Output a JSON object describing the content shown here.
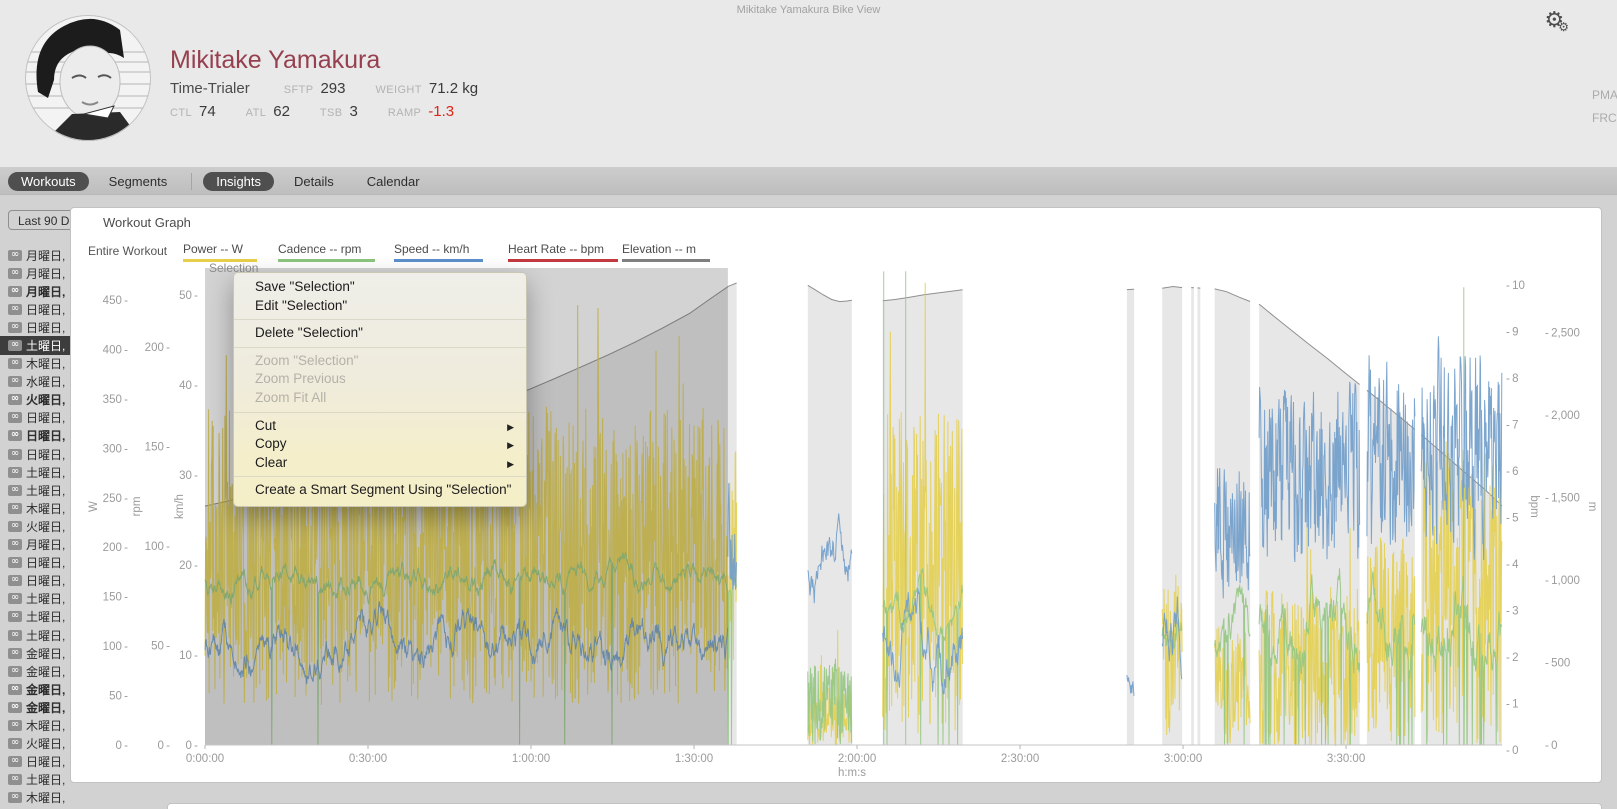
{
  "window": {
    "title": "Mikitake Yamakura Bike View"
  },
  "header": {
    "name": "Mikitake Yamakura",
    "athlete_type": "Time-Trialer",
    "stats_row1": [
      {
        "label": "SFTP",
        "value": "293"
      },
      {
        "label": "WEIGHT",
        "value": "71.2 kg"
      }
    ],
    "stats_row2": [
      {
        "label": "CTL",
        "value": "74"
      },
      {
        "label": "ATL",
        "value": "62"
      },
      {
        "label": "TSB",
        "value": "3"
      },
      {
        "label": "RAMP",
        "value": "-1.3",
        "value_color": "#e02519"
      }
    ],
    "right_metrics": [
      "PMA",
      "FRC"
    ]
  },
  "tabs": [
    {
      "label": "Workouts",
      "selected": true
    },
    {
      "label": "Segments",
      "selected": false,
      "separator_after": true
    },
    {
      "label": "Insights",
      "selected": true
    },
    {
      "label": "Details",
      "selected": false
    },
    {
      "label": "Calendar",
      "selected": false
    }
  ],
  "sidebar": {
    "filter_button": "Last 90 D",
    "items": [
      {
        "label": "月曜日,"
      },
      {
        "label": "月曜日,"
      },
      {
        "label": "月曜日,",
        "bold": true
      },
      {
        "label": "日曜日,"
      },
      {
        "label": "日曜日,"
      },
      {
        "label": "土曜日,",
        "selected": true
      },
      {
        "label": "木曜日,"
      },
      {
        "label": "水曜日,"
      },
      {
        "label": "火曜日,",
        "bold": true
      },
      {
        "label": "日曜日,"
      },
      {
        "label": "日曜日,",
        "bold": true
      },
      {
        "label": "日曜日,"
      },
      {
        "label": "土曜日,"
      },
      {
        "label": "土曜日,"
      },
      {
        "label": "木曜日,"
      },
      {
        "label": "火曜日,"
      },
      {
        "label": "月曜日,"
      },
      {
        "label": "日曜日,"
      },
      {
        "label": "日曜日,"
      },
      {
        "label": "土曜日,"
      },
      {
        "label": "土曜日,"
      },
      {
        "label": "土曜日,"
      },
      {
        "label": "金曜日,"
      },
      {
        "label": "金曜日,"
      },
      {
        "label": "金曜日,",
        "bold": true
      },
      {
        "label": "金曜日,",
        "bold": true
      },
      {
        "label": "木曜日,"
      },
      {
        "label": "火曜日,"
      },
      {
        "label": "日曜日,"
      },
      {
        "label": "土曜日,"
      },
      {
        "label": "木曜日,"
      }
    ]
  },
  "panel": {
    "title": "Workout Graph",
    "scope_label": "Entire Workout",
    "legend": [
      {
        "name": "Power",
        "unit": "W",
        "color": "#e7cf4b"
      },
      {
        "name": "Cadence",
        "unit": "rpm",
        "color": "#8cc47e"
      },
      {
        "name": "Speed",
        "unit": "km/h",
        "color": "#5b90cb"
      },
      {
        "name": "Heart Rate",
        "unit": "bpm",
        "color": "#c2393f"
      },
      {
        "name": "Elevation",
        "unit": "m",
        "color": "#7f7f7f"
      }
    ]
  },
  "context_menu": {
    "items": [
      {
        "label": "Save \"Selection\""
      },
      {
        "label": "Edit \"Selection\""
      },
      {
        "type": "separator"
      },
      {
        "label": "Delete \"Selection\""
      },
      {
        "type": "separator"
      },
      {
        "label": "Zoom \"Selection\"",
        "disabled": true
      },
      {
        "label": "Zoom Previous",
        "disabled": true
      },
      {
        "label": "Zoom Fit All",
        "disabled": true
      },
      {
        "type": "separator"
      },
      {
        "label": "Cut",
        "submenu": true
      },
      {
        "label": "Copy",
        "submenu": true
      },
      {
        "label": "Clear",
        "submenu": true
      },
      {
        "type": "separator"
      },
      {
        "label": "Create a Smart Segment Using \"Selection\""
      }
    ]
  },
  "chart_data": {
    "type": "line",
    "title": "Workout Graph",
    "x_axis": {
      "label": "h:m:s",
      "range_seconds": [
        0,
        14322
      ],
      "tick_interval_seconds": 1800,
      "tick_labels": [
        "0:00:00",
        "0:30:00",
        "1:00:00",
        "1:30:00",
        "2:00:00",
        "2:30:00",
        "3:00:00",
        "3:30:00"
      ]
    },
    "y_axes": [
      {
        "id": "power",
        "title": "W",
        "side": "left",
        "ticks": [
          0,
          50,
          100,
          150,
          200,
          250,
          300,
          350,
          400,
          450
        ]
      },
      {
        "id": "cadence",
        "title": "rpm",
        "side": "left",
        "ticks": [
          0,
          50,
          100,
          150,
          200
        ]
      },
      {
        "id": "speed",
        "title": "km/h",
        "side": "left",
        "ticks": [
          0,
          10,
          20,
          30,
          40,
          50
        ]
      },
      {
        "id": "hr",
        "title": "bpm",
        "side": "right",
        "ticks": [
          0,
          1,
          2,
          3,
          4,
          5,
          6,
          7,
          8,
          9,
          10
        ]
      },
      {
        "id": "elevation",
        "title": "m",
        "side": "right",
        "ticks": [
          0,
          500,
          1000,
          1500,
          2000,
          2500
        ]
      }
    ],
    "selection": {
      "label": "Selection",
      "start_seconds": 0,
      "end_seconds": 5774
    },
    "series": {
      "elevation_m": {
        "color": "#8f8f8f",
        "fill": "#e3e3e3",
        "segments": [
          [
            [
              0,
              1448
            ],
            [
              250,
              1478
            ],
            [
              550,
              1528
            ],
            [
              850,
              1582
            ],
            [
              1150,
              1640
            ],
            [
              1450,
              1700
            ],
            [
              1750,
              1760
            ],
            [
              2050,
              1822
            ],
            [
              2350,
              1886
            ],
            [
              2650,
              1950
            ],
            [
              2950,
              2014
            ],
            [
              3250,
              2080
            ],
            [
              3550,
              2148
            ],
            [
              3850,
              2218
            ],
            [
              4150,
              2290
            ],
            [
              4450,
              2364
            ],
            [
              4750,
              2442
            ],
            [
              5050,
              2526
            ],
            [
              5350,
              2615
            ],
            [
              5600,
              2712
            ],
            [
              5780,
              2780
            ],
            [
              5870,
              2800
            ]
          ],
          [
            [
              6656,
              2786
            ],
            [
              6740,
              2758
            ],
            [
              6820,
              2730
            ],
            [
              6920,
              2700
            ],
            [
              7010,
              2687
            ],
            [
              7090,
              2691
            ],
            [
              7142,
              2695
            ]
          ],
          [
            [
              7483,
              2692
            ],
            [
              7620,
              2700
            ],
            [
              7780,
              2714
            ],
            [
              7940,
              2729
            ],
            [
              8100,
              2740
            ],
            [
              8240,
              2750
            ],
            [
              8366,
              2759
            ]
          ],
          [
            [
              10180,
              2760
            ],
            [
              10260,
              2762
            ]
          ],
          [
            [
              10570,
              2768
            ],
            [
              10690,
              2779
            ],
            [
              10790,
              2772
            ]
          ],
          [
            [
              10890,
              2772
            ],
            [
              10920,
              2771
            ]
          ],
          [
            [
              10960,
              2770
            ],
            [
              10990,
              2769
            ]
          ],
          [
            [
              11150,
              2764
            ],
            [
              11280,
              2747
            ],
            [
              11420,
              2714
            ],
            [
              11540,
              2688
            ]
          ],
          [
            [
              11640,
              2672
            ],
            [
              11800,
              2600
            ],
            [
              12000,
              2512
            ],
            [
              12200,
              2425
            ],
            [
              12400,
              2340
            ],
            [
              12600,
              2250
            ],
            [
              12750,
              2185
            ]
          ],
          [
            [
              12830,
              2150
            ],
            [
              13000,
              2075
            ],
            [
              13200,
              1985
            ],
            [
              13360,
              1912
            ]
          ],
          [
            [
              13430,
              1880
            ],
            [
              13600,
              1800
            ],
            [
              13800,
              1705
            ],
            [
              14000,
              1610
            ],
            [
              14150,
              1540
            ],
            [
              14322,
              1450
            ]
          ]
        ]
      },
      "power_w": {
        "color": "#e4cf4e",
        "style": "jagged",
        "segments": [
          {
            "t0": 0,
            "t1": 5870,
            "base": 190,
            "amp": 150,
            "spike_p": 0.05,
            "spike": 130
          },
          {
            "t0": 6656,
            "t1": 7142,
            "base": 28,
            "amp": 30,
            "spike_p": 0.03,
            "spike": 90
          },
          {
            "t0": 7483,
            "t1": 8366,
            "base": 175,
            "amp": 165,
            "spike_p": 0.06,
            "spike": 150
          },
          {
            "t0": 10570,
            "t1": 10790,
            "base": 90,
            "amp": 85
          },
          {
            "t0": 11150,
            "t1": 11540,
            "base": 60,
            "amp": 60
          },
          {
            "t0": 11640,
            "t1": 12750,
            "base": 75,
            "amp": 85,
            "spike_p": 0.04,
            "spike": 150
          },
          {
            "t0": 12830,
            "t1": 13360,
            "base": 105,
            "amp": 105,
            "spike_p": 0.05,
            "spike": 160
          },
          {
            "t0": 13430,
            "t1": 14322,
            "base": 150,
            "amp": 150,
            "spike_p": 0.06,
            "spike": 170
          }
        ]
      },
      "cadence_rpm": {
        "color": "#93c783",
        "style": "walk",
        "segments": [
          {
            "t0": 0,
            "t1": 5870,
            "base": 83,
            "amp": 9,
            "style": "walk",
            "drop_p": 0.012
          },
          {
            "t0": 6656,
            "t1": 7142,
            "base": 22,
            "amp": 22,
            "style": "jagged"
          },
          {
            "t0": 7483,
            "t1": 8366,
            "base": 68,
            "amp": 14,
            "style": "walk",
            "drop_p": 0.04
          },
          {
            "t0": 10570,
            "t1": 10790,
            "base": 55,
            "amp": 18,
            "style": "walk"
          },
          {
            "t0": 11150,
            "t1": 11540,
            "base": 50,
            "amp": 20,
            "style": "walk",
            "drop_p": 0.05
          },
          {
            "t0": 11640,
            "t1": 12750,
            "base": 55,
            "amp": 24,
            "style": "walk",
            "drop_p": 0.07
          },
          {
            "t0": 12830,
            "t1": 13360,
            "base": 60,
            "amp": 24,
            "style": "walk",
            "drop_p": 0.07
          },
          {
            "t0": 13430,
            "t1": 14322,
            "base": 62,
            "amp": 25,
            "style": "walk",
            "drop_p": 0.09
          }
        ],
        "glitch_spikes": [
          {
            "t": 7494,
            "v": 238
          },
          {
            "t": 7737,
            "v": 238
          },
          {
            "t": 13900,
            "v": 230
          }
        ]
      },
      "speed_kmh": {
        "color": "#6f9cca",
        "style": "walk",
        "segments": [
          {
            "t0": 0,
            "t1": 5774,
            "base": 11.5,
            "amp": 3,
            "style": "walk"
          },
          {
            "t0": 5774,
            "t1": 5870,
            "base": 23,
            "amp": 8,
            "style": "jagged2"
          },
          {
            "t0": 6656,
            "t1": 7142,
            "base": 21,
            "amp": 5,
            "style": "walk"
          },
          {
            "t0": 7483,
            "t1": 8366,
            "base": 12,
            "amp": 5,
            "style": "walk"
          },
          {
            "t0": 10180,
            "t1": 10260,
            "base": 8,
            "amp": 3,
            "style": "walk"
          },
          {
            "t0": 10570,
            "t1": 10790,
            "base": 12,
            "amp": 6,
            "style": "walk"
          },
          {
            "t0": 11150,
            "t1": 11540,
            "base": 25,
            "amp": 10,
            "style": "jagged2"
          },
          {
            "t0": 11640,
            "t1": 12750,
            "base": 30,
            "amp": 13,
            "style": "jagged2"
          },
          {
            "t0": 12830,
            "t1": 13360,
            "base": 32,
            "amp": 14,
            "style": "jagged2"
          },
          {
            "t0": 13430,
            "t1": 14322,
            "base": 33,
            "amp": 14,
            "style": "jagged2"
          }
        ]
      },
      "heart_rate_bpm": {
        "color": "#c2393f",
        "segments": []
      }
    }
  }
}
